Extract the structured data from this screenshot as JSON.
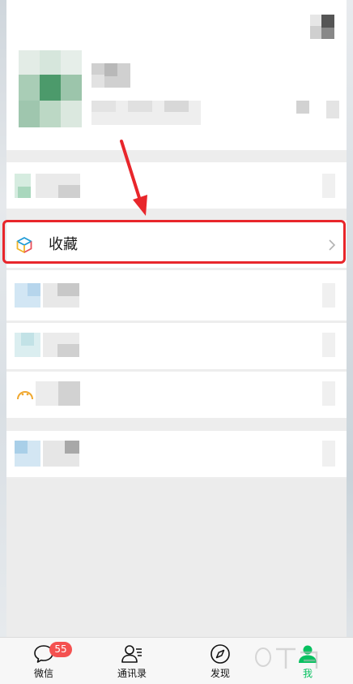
{
  "favorites_row": {
    "label": "收藏",
    "icon": "cube-icon",
    "highlight_color": "#e8262b"
  },
  "tabbar": {
    "tabs": [
      {
        "label": "微信",
        "icon": "chat-bubble-icon",
        "badge": "55",
        "active": false
      },
      {
        "label": "通讯录",
        "icon": "contacts-icon",
        "active": false
      },
      {
        "label": "发现",
        "icon": "compass-icon",
        "active": false
      },
      {
        "label": "我",
        "icon": "person-icon",
        "active": true
      }
    ],
    "active_color": "#07c160"
  },
  "colors": {
    "accent_green": "#07c160",
    "badge_red": "#f45150",
    "annotation_red": "#e8262b"
  }
}
